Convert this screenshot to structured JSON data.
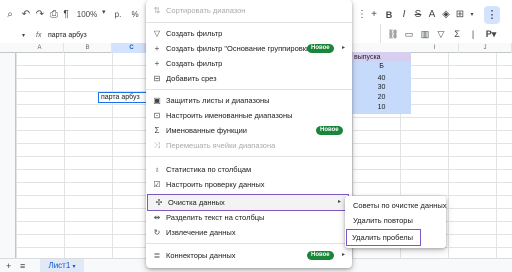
{
  "toolbar": {
    "zoom": "100%",
    "currency": "р.",
    "percent": "%"
  },
  "formula_bar": {
    "fx": "fx",
    "value": "парта арбуз"
  },
  "columns": [
    "A",
    "B",
    "C",
    "I",
    "J"
  ],
  "cells": {
    "text_cell": "парта арбуз",
    "header_partial": "выпуска",
    "letter": "Б",
    "values": [
      "40",
      "30",
      "20",
      "10"
    ]
  },
  "sheetbar": {
    "tab": "Лист1"
  },
  "menu": {
    "items": [
      {
        "label": "Сортировать диапазон",
        "icon": "sort-icon",
        "disabled": true
      },
      {
        "label": "Создать фильтр",
        "icon": "filter-icon"
      },
      {
        "label": "Создать фильтр \"Основание группировки\"",
        "icon": "plus-icon",
        "badge": "Новое",
        "arrow": true
      },
      {
        "label": "Создать фильтр",
        "icon": "plus-icon"
      },
      {
        "label": "Добавить срез",
        "icon": "slicer-icon"
      },
      {
        "label": "Защитить листы и диапазоны",
        "icon": "lock-icon"
      },
      {
        "label": "Настроить именованные диапазоны",
        "icon": "named-range-icon"
      },
      {
        "label": "Именованные функции",
        "icon": "sigma-icon",
        "badge": "Новое"
      },
      {
        "label": "Перемешать ячейки диапазона",
        "icon": "shuffle-icon",
        "disabled": true
      },
      {
        "label": "Статистика по столбцам",
        "icon": "bulb-icon"
      },
      {
        "label": "Настроить проверку данных",
        "icon": "validation-icon"
      },
      {
        "label": "Очистка данных",
        "icon": "cleanup-icon",
        "arrow": true
      },
      {
        "label": "Разделить текст на столбцы",
        "icon": "split-icon"
      },
      {
        "label": "Извлечение данных",
        "icon": "extract-icon"
      },
      {
        "label": "Коннекторы данных",
        "icon": "database-icon",
        "badge": "Новое",
        "arrow": true
      }
    ]
  },
  "submenu": {
    "items": [
      "Советы по очистке данных",
      "Удалить повторы",
      "Удалить пробелы"
    ]
  },
  "colors": {
    "accent": "#0b57d0",
    "badge": "#198639",
    "highlight_outline": "#7e57c2",
    "selected_cells": "#c6dafc"
  }
}
